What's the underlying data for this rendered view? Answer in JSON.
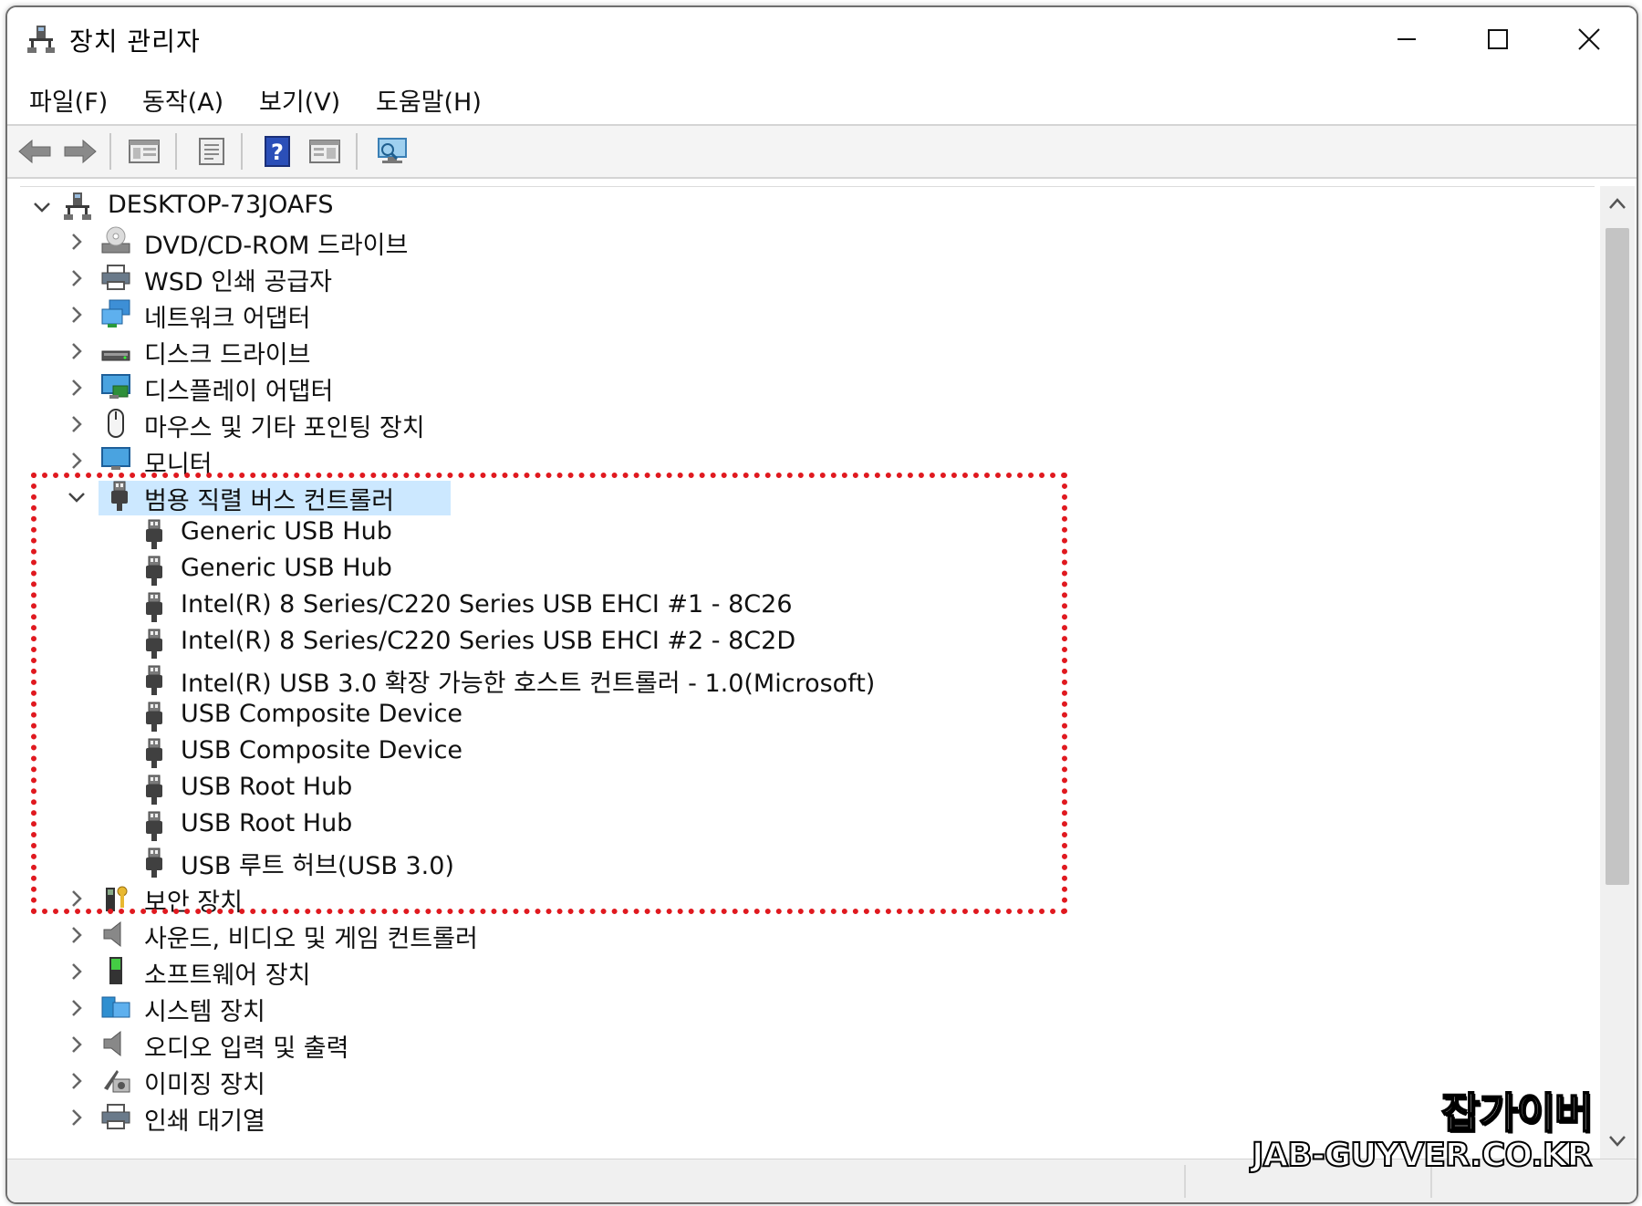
{
  "window": {
    "title": "장치 관리자"
  },
  "menu": {
    "items": [
      {
        "label": "파일(F)"
      },
      {
        "label": "동작(A)"
      },
      {
        "label": "보기(V)"
      },
      {
        "label": "도움말(H)"
      }
    ]
  },
  "tree": {
    "root": "DESKTOP-73JOAFS",
    "categories_top": [
      {
        "label": "DVD/CD-ROM 드라이브",
        "icon": "dvd-drive-icon"
      },
      {
        "label": "WSD 인쇄 공급자",
        "icon": "printer-icon"
      },
      {
        "label": "네트워크 어댑터",
        "icon": "network-adapter-icon"
      },
      {
        "label": "디스크 드라이브",
        "icon": "disk-drive-icon"
      },
      {
        "label": "디스플레이 어댑터",
        "icon": "display-adapter-icon"
      },
      {
        "label": "마우스 및 기타 포인팅 장치",
        "icon": "mouse-icon"
      },
      {
        "label": "모니터",
        "icon": "monitor-icon"
      }
    ],
    "expanded": {
      "label": "범용 직렬 버스 컨트롤러",
      "icon": "usb-icon",
      "children": [
        "Generic USB Hub",
        "Generic USB Hub",
        "Intel(R) 8 Series/C220 Series USB EHCI #1 - 8C26",
        "Intel(R) 8 Series/C220 Series USB EHCI #2 - 8C2D",
        "Intel(R) USB 3.0 확장 가능한 호스트 컨트롤러 - 1.0(Microsoft)",
        "USB Composite Device",
        "USB Composite Device",
        "USB Root Hub",
        "USB Root Hub",
        "USB 루트 허브(USB 3.0)"
      ]
    },
    "categories_bottom": [
      {
        "label": "보안 장치",
        "icon": "security-device-icon"
      },
      {
        "label": "사운드, 비디오 및 게임 컨트롤러",
        "icon": "speaker-icon"
      },
      {
        "label": "소프트웨어 장치",
        "icon": "software-device-icon"
      },
      {
        "label": "시스템 장치",
        "icon": "system-device-icon"
      },
      {
        "label": "오디오 입력 및 출력",
        "icon": "audio-io-icon"
      },
      {
        "label": "이미징 장치",
        "icon": "imaging-device-icon"
      },
      {
        "label": "인쇄 대기열",
        "icon": "print-queue-icon"
      }
    ]
  },
  "colors": {
    "selection": "#cce8ff",
    "highlight_border": "#e0191f",
    "usb_plug": "#505050"
  },
  "watermark": {
    "line1": "잡가이버",
    "line2": "JAB-GUYVER.CO.KR"
  }
}
